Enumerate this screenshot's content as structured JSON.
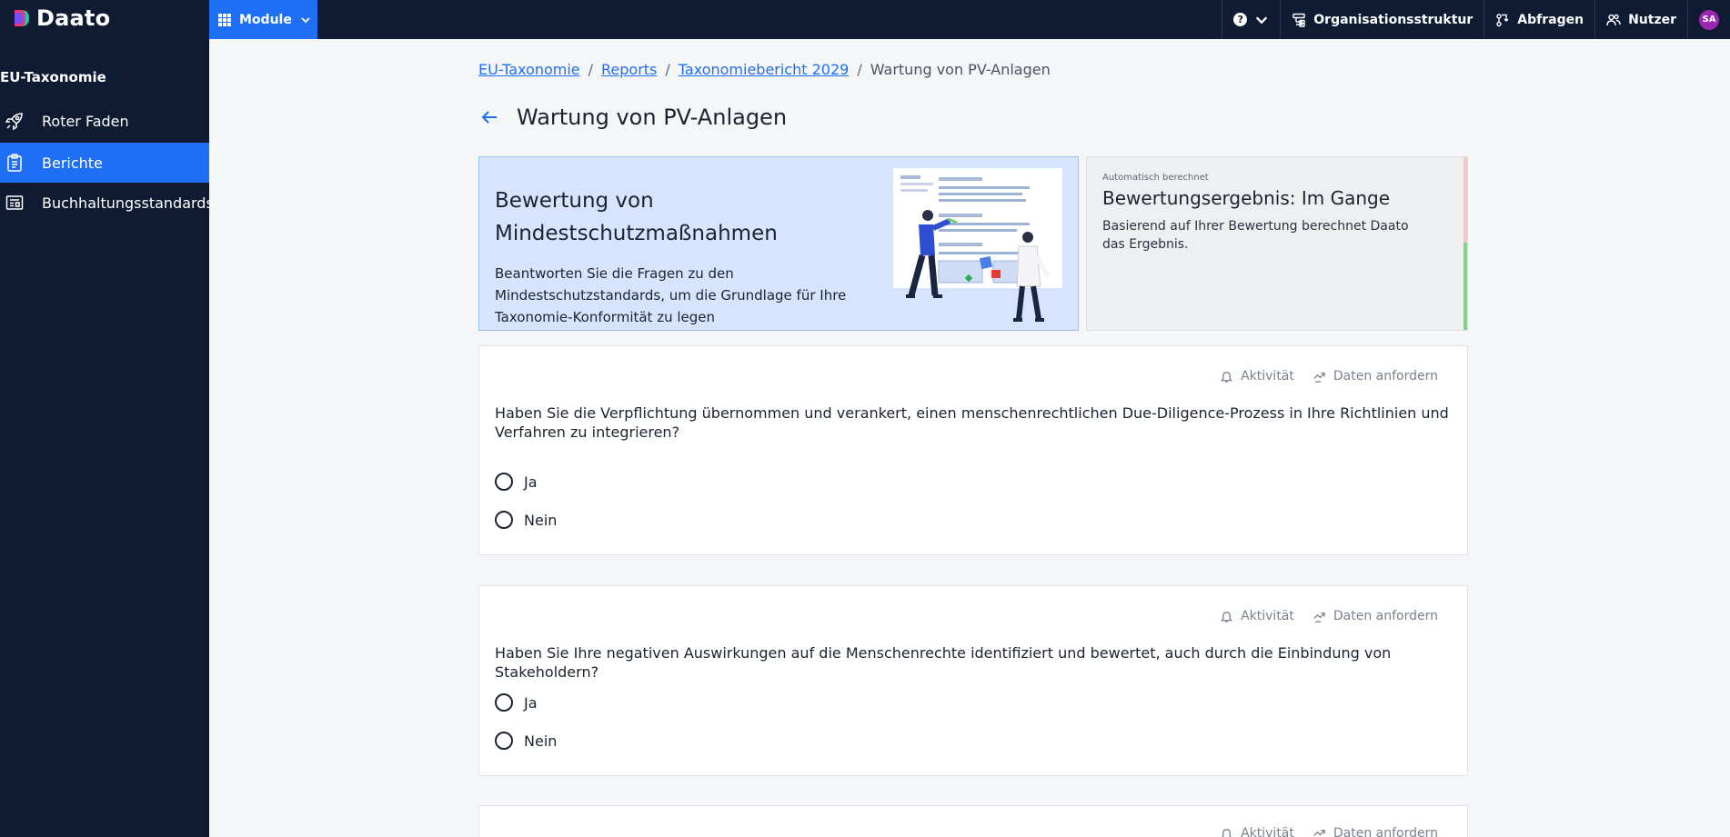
{
  "brand": {
    "name": "Daato"
  },
  "topbar": {
    "module_label": "Module",
    "nav": [
      {
        "label": "Organisationsstruktur",
        "icon": "org-structure-icon"
      },
      {
        "label": "Abfragen",
        "icon": "requests-icon"
      },
      {
        "label": "Nutzer",
        "icon": "users-icon"
      }
    ],
    "help_icon": "?",
    "avatar_initials": "SA",
    "colors": {
      "bar": "#0f1b33",
      "accent": "#1e6ff3",
      "avatar": "#9b27b0"
    }
  },
  "sidebar": {
    "title": "EU-Taxonomie",
    "items": [
      {
        "label": "Roter Faden",
        "icon": "rocket-icon",
        "active": false
      },
      {
        "label": "Berichte",
        "icon": "clipboard-icon",
        "active": true
      },
      {
        "label": "Buchhaltungsstandards",
        "icon": "ledger-icon",
        "active": false
      }
    ]
  },
  "breadcrumb": {
    "items": [
      {
        "label": "EU-Taxonomie",
        "link": true
      },
      {
        "label": "Reports",
        "link": true
      },
      {
        "label": "Taxonomiebericht 2029",
        "link": true
      },
      {
        "label": "Wartung von PV-Anlagen",
        "link": false
      }
    ],
    "separator": "/"
  },
  "page": {
    "title": "Wartung von PV-Anlagen"
  },
  "banner": {
    "title": "Bewertung von Mindestschutzmaßnahmen",
    "text": "Beantworten Sie die Fragen zu den Mindestschutzstandards, um die Grundlage für Ihre Taxonomie-Konformität zu legen"
  },
  "result": {
    "caption": "Automatisch berechnet",
    "title": "Bewertungsergebnis: Im Gange",
    "text": "Basierend auf Ihrer Bewertung berechnet Daato das Ergebnis."
  },
  "question_actions": {
    "activity": "Aktivität",
    "request_data": "Daten anfordern"
  },
  "questions": [
    {
      "text": "Haben Sie die Verpflichtung übernommen und verankert, einen menschenrechtlichen Due-Diligence-Prozess in Ihre Richtlinien und Verfahren zu integrieren?",
      "options": [
        "Ja",
        "Nein"
      ]
    },
    {
      "text": "Haben Sie Ihre negativen Auswirkungen auf die Menschenrechte identifiziert und bewertet, auch durch die Einbindung von Stakeholdern?",
      "options": [
        "Ja",
        "Nein"
      ]
    }
  ]
}
